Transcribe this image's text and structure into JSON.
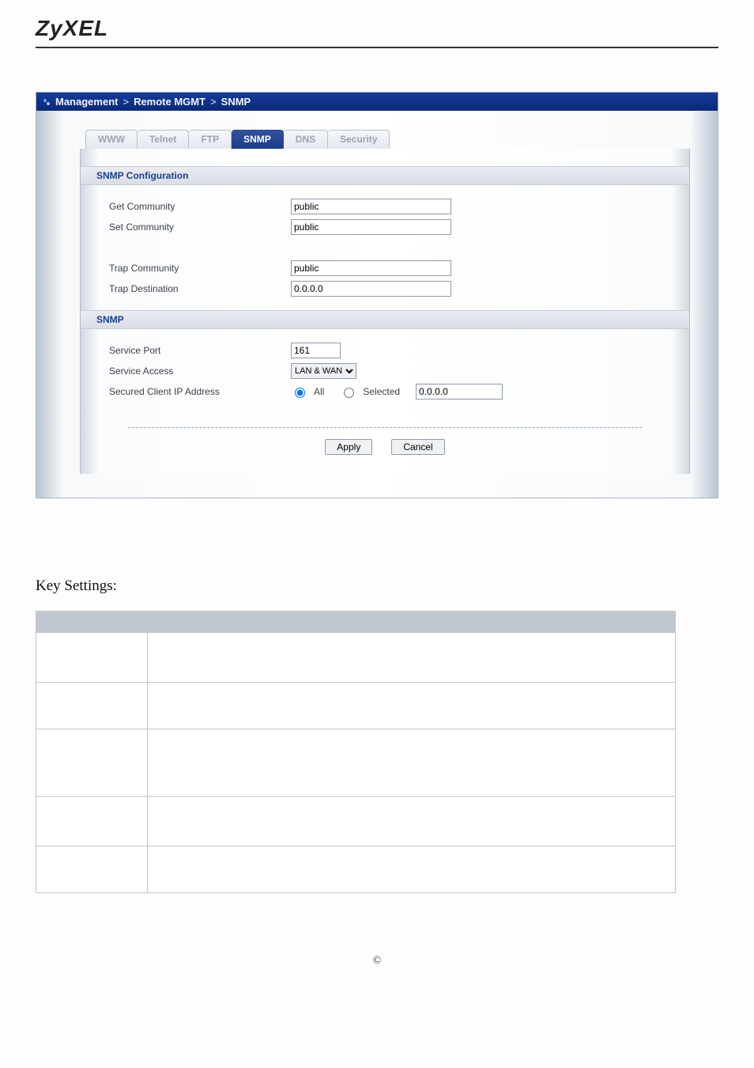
{
  "logo_text": "ZyXEL",
  "breadcrumb": {
    "parts": [
      "Management",
      "Remote MGMT",
      "SNMP"
    ]
  },
  "tabs": [
    {
      "label": "WWW",
      "active": false
    },
    {
      "label": "Telnet",
      "active": false
    },
    {
      "label": "FTP",
      "active": false
    },
    {
      "label": "SNMP",
      "active": true
    },
    {
      "label": "DNS",
      "active": false
    },
    {
      "label": "Security",
      "active": false
    }
  ],
  "sections": {
    "snmp_config": {
      "title": "SNMP Configuration",
      "fields": {
        "get_community": {
          "label": "Get Community",
          "value": "public"
        },
        "set_community": {
          "label": "Set Community",
          "value": "public"
        },
        "trap_community": {
          "label": "Trap  Community",
          "value": "public"
        },
        "trap_destination": {
          "label": "Trap  Destination",
          "value": "0.0.0.0"
        }
      }
    },
    "snmp": {
      "title": "SNMP",
      "fields": {
        "service_port": {
          "label": "Service Port",
          "value": "161"
        },
        "service_access": {
          "label": "Service Access",
          "value": "LAN & WAN"
        },
        "secured_client": {
          "label": "Secured Client IP Address",
          "radio_all": "All",
          "radio_selected": "Selected",
          "ip_value": "0.0.0.0",
          "selected_radio": "all"
        }
      }
    }
  },
  "buttons": {
    "apply": "Apply",
    "cancel": "Cancel"
  },
  "key_settings_heading": "Key Settings:",
  "footer_copyright": "©"
}
